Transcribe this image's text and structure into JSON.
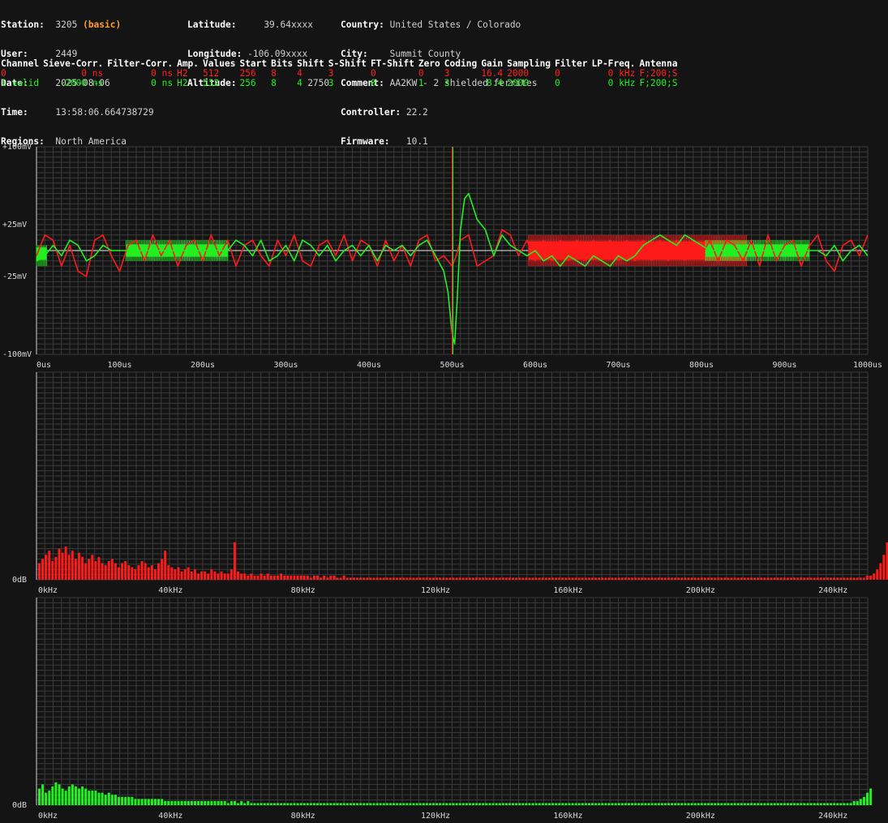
{
  "header": {
    "station_label": "Station:",
    "station": "3205",
    "station_tag": "(basic)",
    "user_label": "User:",
    "user": "2449",
    "date_label": "Date:",
    "date": "2025-08-06",
    "time_label": "Time:",
    "time": "13:58:06.664738729",
    "regions_label": "Regions:",
    "regions": "North America",
    "latitude_label": "Latitude:",
    "latitude": "39.64xxxx",
    "longitude_label": "Longitude:",
    "longitude": "-106.09xxxx",
    "altitude_label": "Altitude:",
    "altitude": "2750",
    "country_label": "Country:",
    "country": "United States / Colorado",
    "city_label": "City:",
    "city": "Summit County",
    "comment_label": "Comment:",
    "comment": "AA2KW - 2 shielded ferrites",
    "controller_label": "Controller:",
    "controller": "22.2",
    "firmware_label": "Firmware:",
    "firmware": "10.1"
  },
  "channel_table": {
    "columns": [
      "Channel",
      "Sieve-Corr.",
      "Filter-Corr.",
      "Amp.",
      "Values",
      "Start",
      "Bits",
      "Shift",
      "S-Shift",
      "FT-Shift",
      "Zero",
      "Coding",
      "Gain",
      "Sampling",
      "Filter",
      "LP-Freq.",
      "Antenna"
    ],
    "rows": [
      [
        "0",
        "0 ns",
        "0 ns",
        "H2",
        "512",
        "256",
        "8",
        "4",
        "3",
        "0",
        "0",
        "3",
        "16.4",
        "2000",
        "0",
        "0 kHz",
        "F;200;S"
      ],
      [
        "1 valid",
        "-2000 ns",
        "0 ns",
        "H2",
        "512",
        "256",
        "8",
        "4",
        "3",
        "0",
        "1",
        "3",
        "8.4",
        "2000",
        "0",
        "0 kHz",
        "F;200;S"
      ]
    ]
  },
  "colors": {
    "channel0": "#ff1a1a",
    "channel1": "#22ee22",
    "grid": "#3a3a3a",
    "background": "#141414"
  },
  "chart_data": [
    {
      "type": "line",
      "y_tick_labels": [
        "+100mV",
        "+25mV",
        "-25mV",
        "-100mV"
      ],
      "x_tick_labels": [
        "0us",
        "100us",
        "200us",
        "300us",
        "400us",
        "500us",
        "600us",
        "700us",
        "800us",
        "900us",
        "1000us"
      ],
      "xlim": [
        0,
        1000
      ],
      "ylim": [
        -100,
        100
      ],
      "y_ticks": [
        100,
        25,
        -25,
        -100
      ],
      "x_ticks": [
        0,
        100,
        200,
        300,
        400,
        500,
        600,
        700,
        800,
        900,
        1000
      ],
      "marker_x": 500,
      "series": [
        {
          "name": "0",
          "x": [
            0,
            10,
            20,
            30,
            40,
            50,
            60,
            70,
            80,
            90,
            100,
            110,
            120,
            130,
            140,
            150,
            160,
            170,
            180,
            190,
            200,
            210,
            220,
            230,
            240,
            250,
            260,
            270,
            280,
            290,
            300,
            310,
            320,
            330,
            340,
            350,
            360,
            370,
            380,
            390,
            400,
            410,
            420,
            430,
            440,
            450,
            460,
            470,
            480,
            490,
            500,
            505,
            510,
            520,
            530,
            540,
            550,
            560,
            570,
            580,
            590,
            600,
            610,
            620,
            630,
            640,
            650,
            660,
            670,
            680,
            690,
            700,
            710,
            720,
            730,
            740,
            750,
            760,
            770,
            780,
            790,
            800,
            810,
            820,
            830,
            840,
            850,
            860,
            870,
            880,
            890,
            900,
            910,
            920,
            930,
            940,
            950,
            960,
            970,
            980,
            990,
            1000
          ],
          "y": [
            -5,
            15,
            10,
            -15,
            5,
            -20,
            -25,
            10,
            15,
            -5,
            -20,
            5,
            10,
            -10,
            15,
            -5,
            10,
            -15,
            5,
            10,
            -10,
            15,
            -5,
            10,
            -15,
            5,
            10,
            -5,
            -15,
            10,
            -5,
            15,
            -10,
            -15,
            5,
            10,
            -5,
            15,
            -10,
            10,
            5,
            -15,
            10,
            -10,
            5,
            -15,
            10,
            15,
            -10,
            -5,
            -15,
            -5,
            10,
            15,
            -15,
            -10,
            -5,
            20,
            15,
            -5,
            10,
            -10,
            10,
            -10,
            10,
            -10,
            10,
            -10,
            10,
            -10,
            10,
            -10,
            10,
            -10,
            10,
            -10,
            10,
            -10,
            10,
            -10,
            10,
            -5,
            10,
            -10,
            10,
            5,
            -10,
            10,
            -15,
            15,
            -10,
            5,
            10,
            -15,
            5,
            15,
            -10,
            -20,
            5,
            10,
            -5,
            15
          ]
        },
        {
          "name": "1",
          "x": [
            0,
            10,
            20,
            30,
            40,
            50,
            60,
            70,
            80,
            90,
            100,
            110,
            120,
            130,
            140,
            150,
            160,
            170,
            180,
            190,
            200,
            210,
            220,
            230,
            240,
            250,
            260,
            270,
            280,
            290,
            300,
            310,
            320,
            330,
            340,
            350,
            360,
            370,
            380,
            390,
            400,
            410,
            420,
            430,
            440,
            450,
            460,
            470,
            480,
            490,
            495,
            500,
            503,
            506,
            510,
            515,
            520,
            530,
            540,
            550,
            560,
            570,
            580,
            590,
            600,
            610,
            620,
            630,
            640,
            650,
            660,
            670,
            680,
            690,
            700,
            710,
            720,
            730,
            740,
            750,
            760,
            770,
            780,
            790,
            800,
            810,
            820,
            830,
            840,
            850,
            860,
            870,
            880,
            890,
            900,
            910,
            920,
            930,
            940,
            950,
            960,
            970,
            980,
            990,
            1000
          ],
          "y": [
            -10,
            -5,
            5,
            -5,
            10,
            5,
            -10,
            -5,
            5,
            0,
            0,
            0,
            0,
            0,
            0,
            0,
            0,
            0,
            0,
            0,
            0,
            0,
            0,
            0,
            10,
            5,
            -5,
            10,
            -10,
            -5,
            5,
            -10,
            10,
            5,
            -5,
            5,
            -10,
            0,
            5,
            -5,
            5,
            -10,
            5,
            0,
            5,
            -5,
            5,
            10,
            -5,
            -20,
            -40,
            -80,
            -90,
            -50,
            20,
            50,
            55,
            30,
            20,
            -5,
            15,
            5,
            0,
            -5,
            0,
            -10,
            -5,
            -15,
            -5,
            -10,
            -15,
            -5,
            -10,
            -15,
            -5,
            -10,
            -5,
            5,
            10,
            15,
            10,
            5,
            15,
            10,
            5,
            0,
            0,
            0,
            0,
            0,
            0,
            0,
            0,
            0,
            0,
            0,
            0,
            0,
            0,
            -5,
            5,
            -10,
            0,
            5,
            -5
          ]
        }
      ],
      "dense_bands": [
        {
          "series": "1",
          "from": 0,
          "to": 12,
          "top": 5,
          "bottom": -15
        },
        {
          "series": "1",
          "from": 108,
          "to": 230,
          "top": 10,
          "bottom": -10
        },
        {
          "series": "0",
          "from": 592,
          "to": 855,
          "top": 15,
          "bottom": -15
        },
        {
          "series": "1",
          "from": 805,
          "to": 930,
          "top": 10,
          "bottom": -10
        }
      ]
    },
    {
      "type": "bar",
      "series_name": "0",
      "y_tick_labels": [
        "0dB"
      ],
      "x_tick_labels": [
        "0kHz",
        "40kHz",
        "80kHz",
        "120kHz",
        "160kHz",
        "200kHz",
        "240kHz"
      ],
      "xlim": [
        0,
        250
      ],
      "bin_khz": 1,
      "values": [
        8,
        10,
        12,
        14,
        9,
        11,
        15,
        13,
        16,
        12,
        14,
        10,
        13,
        11,
        8,
        10,
        12,
        9,
        11,
        8,
        7,
        9,
        10,
        8,
        6,
        8,
        9,
        7,
        6,
        5,
        7,
        9,
        8,
        6,
        7,
        5,
        8,
        10,
        14,
        7,
        6,
        5,
        6,
        4,
        5,
        6,
        4,
        5,
        3,
        4,
        4,
        3,
        5,
        4,
        3,
        4,
        3,
        3,
        5,
        18,
        4,
        3,
        3,
        2,
        3,
        2,
        2,
        3,
        2,
        3,
        2,
        2,
        2,
        3,
        2,
        2,
        2,
        2,
        2,
        2,
        2,
        2,
        1,
        2,
        2,
        1,
        2,
        1,
        2,
        2,
        1,
        1,
        2,
        1,
        1,
        1,
        1,
        1,
        1,
        1,
        1,
        1,
        1,
        1,
        1,
        1,
        1,
        1,
        1,
        1,
        1,
        1,
        1,
        1,
        1,
        1,
        1,
        1,
        1,
        1,
        1,
        1,
        1,
        1,
        1,
        1,
        1,
        1,
        1,
        1,
        1,
        1,
        1,
        1,
        1,
        1,
        1,
        1,
        1,
        1,
        1,
        1,
        1,
        1,
        1,
        1,
        1,
        1,
        1,
        1,
        1,
        1,
        1,
        1,
        1,
        1,
        1,
        1,
        1,
        1,
        1,
        1,
        1,
        1,
        1,
        1,
        1,
        1,
        1,
        1,
        1,
        1,
        1,
        1,
        1,
        1,
        1,
        1,
        1,
        1,
        1,
        1,
        1,
        1,
        1,
        1,
        1,
        1,
        1,
        1,
        1,
        1,
        1,
        1,
        1,
        1,
        1,
        1,
        1,
        1,
        1,
        1,
        1,
        1,
        1,
        1,
        1,
        1,
        1,
        1,
        1,
        1,
        1,
        1,
        1,
        1,
        1,
        1,
        1,
        1,
        1,
        1,
        1,
        1,
        1,
        1,
        1,
        1,
        1,
        1,
        1,
        1,
        1,
        1,
        1,
        1,
        1,
        1,
        1,
        1,
        1,
        1,
        1,
        1,
        1,
        1,
        1,
        1,
        1,
        1,
        2,
        2,
        3,
        5,
        8,
        12,
        18,
        24,
        27
      ],
      "ylim": [
        0,
        100
      ]
    },
    {
      "type": "bar",
      "series_name": "1",
      "y_tick_labels": [
        "0dB"
      ],
      "x_tick_labels": [
        "0kHz",
        "40kHz",
        "80kHz",
        "120kHz",
        "160kHz",
        "200kHz",
        "240kHz"
      ],
      "xlim": [
        0,
        250
      ],
      "bin_khz": 1,
      "values": [
        8,
        10,
        6,
        7,
        9,
        11,
        10,
        8,
        7,
        9,
        10,
        9,
        8,
        9,
        8,
        7,
        7,
        7,
        6,
        6,
        5,
        6,
        5,
        5,
        4,
        4,
        4,
        4,
        4,
        3,
        3,
        3,
        3,
        3,
        3,
        3,
        3,
        3,
        2,
        2,
        2,
        2,
        2,
        2,
        2,
        2,
        2,
        2,
        2,
        2,
        2,
        2,
        2,
        2,
        2,
        2,
        2,
        1,
        2,
        2,
        1,
        2,
        1,
        2,
        1,
        1,
        1,
        1,
        1,
        1,
        1,
        1,
        1,
        1,
        1,
        1,
        1,
        1,
        1,
        1,
        1,
        1,
        1,
        1,
        1,
        1,
        1,
        1,
        1,
        1,
        1,
        1,
        1,
        1,
        1,
        1,
        1,
        1,
        1,
        1,
        1,
        1,
        1,
        1,
        1,
        1,
        1,
        1,
        1,
        1,
        1,
        1,
        1,
        1,
        1,
        1,
        1,
        1,
        1,
        1,
        1,
        1,
        1,
        1,
        1,
        1,
        1,
        1,
        1,
        1,
        1,
        1,
        1,
        1,
        1,
        1,
        1,
        1,
        1,
        1,
        1,
        1,
        1,
        1,
        1,
        1,
        1,
        1,
        1,
        1,
        1,
        1,
        1,
        1,
        1,
        1,
        1,
        1,
        1,
        1,
        1,
        1,
        1,
        1,
        1,
        1,
        1,
        1,
        1,
        1,
        1,
        1,
        1,
        1,
        1,
        1,
        1,
        1,
        1,
        1,
        1,
        1,
        1,
        1,
        1,
        1,
        1,
        1,
        1,
        1,
        1,
        1,
        1,
        1,
        1,
        1,
        1,
        1,
        1,
        1,
        1,
        1,
        1,
        1,
        1,
        1,
        1,
        1,
        1,
        1,
        1,
        1,
        1,
        1,
        1,
        1,
        1,
        1,
        1,
        1,
        1,
        1,
        1,
        1,
        1,
        1,
        1,
        1,
        1,
        1,
        1,
        1,
        1,
        1,
        1,
        1,
        1,
        1,
        1,
        1,
        1,
        1,
        1,
        1,
        1,
        1,
        2,
        2,
        3,
        4,
        6,
        8
      ],
      "ylim": [
        0,
        100
      ]
    }
  ]
}
